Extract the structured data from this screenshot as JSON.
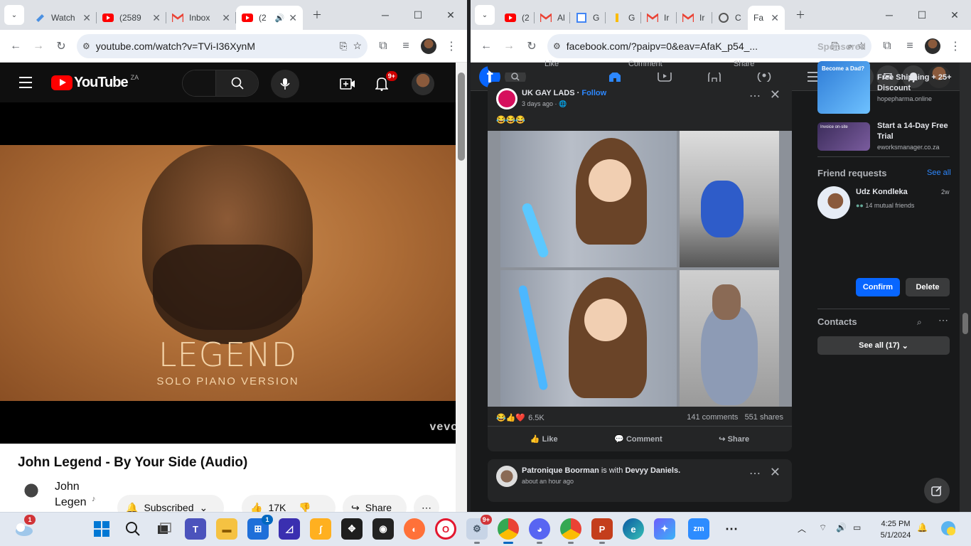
{
  "left_browser": {
    "tabs": [
      {
        "label": "Watch",
        "icon": "document-icon"
      },
      {
        "label": "(2589",
        "icon": "youtube-icon"
      },
      {
        "label": "Inbox",
        "icon": "gmail-icon"
      },
      {
        "label": "(2",
        "icon": "youtube-icon",
        "active": true
      }
    ],
    "url": "youtube.com/watch?v=TVi-I36XynM",
    "youtube": {
      "logo_text": "YouTube",
      "region": "ZA",
      "notif_badge": "9+",
      "album_title": "LEGEND",
      "album_subtitle": "SOLO PIANO VERSION",
      "watermark": "vevo",
      "video_title": "John Legend - By Your Side (Audio)",
      "channel_name": "John Legen",
      "subscribe_label": "Subscribed",
      "likes": "17K",
      "share_label": "Share",
      "more_label": "⋯"
    }
  },
  "right_browser": {
    "tabs": [
      {
        "label": "(2",
        "icon": "youtube-icon"
      },
      {
        "label": "Al",
        "icon": "gmail-icon"
      },
      {
        "label": "G",
        "icon": "calendar-icon"
      },
      {
        "label": "G",
        "icon": "google-icon"
      },
      {
        "label": "Ir",
        "icon": "gmail-icon"
      },
      {
        "label": "Ir",
        "icon": "gmail-icon"
      },
      {
        "label": "C",
        "icon": "openai-icon"
      },
      {
        "label": "Fa",
        "icon": "facebook-icon",
        "active": true
      }
    ],
    "url": "facebook.com/?paipv=0&eav=AfaK_p54_...",
    "facebook": {
      "prev_actions": [
        "Like",
        "Comment",
        "Share"
      ],
      "post": {
        "author": "UK GAY LADS",
        "follow_label": "Follow",
        "time": "3 days ago",
        "emoji_text": "😂😂😂",
        "reactions_count": "6.5K",
        "comments": "141 comments",
        "shares": "551 shares",
        "actions": [
          "Like",
          "Comment",
          "Share"
        ]
      },
      "next_post": {
        "author": "Patronique Boorman",
        "with_text": "is with",
        "with_name": "Devyy Daniels.",
        "time": "about an hour ago"
      },
      "sidebar": {
        "sponsored_heading": "Sponsored",
        "ads": [
          {
            "title": "Free Shipping + 25+ Discount",
            "domain": "hopepharma.online",
            "image_text": "Become a Dad?"
          },
          {
            "title": "Start a 14-Day Free Trial",
            "domain": "eworksmanager.co.za",
            "image_text": "Invoice on-site"
          }
        ],
        "friend_requests_heading": "Friend requests",
        "see_all": "See all",
        "request": {
          "name": "Udz Kondleka",
          "age": "2w",
          "mutual": "14 mutual friends",
          "confirm": "Confirm",
          "delete": "Delete"
        },
        "contacts_heading": "Contacts",
        "see_all_contacts": "See all (17)"
      }
    }
  },
  "taskbar": {
    "weather_badge": "1",
    "store_badge": "1",
    "chrome_badge": "9+",
    "time": "4:25 PM",
    "date": "5/1/2024"
  },
  "colors": {
    "youtube_red": "#ff0000",
    "facebook_blue": "#0866ff",
    "fb_link": "#2d88ff",
    "taskbar_accent": "#0067c0"
  }
}
